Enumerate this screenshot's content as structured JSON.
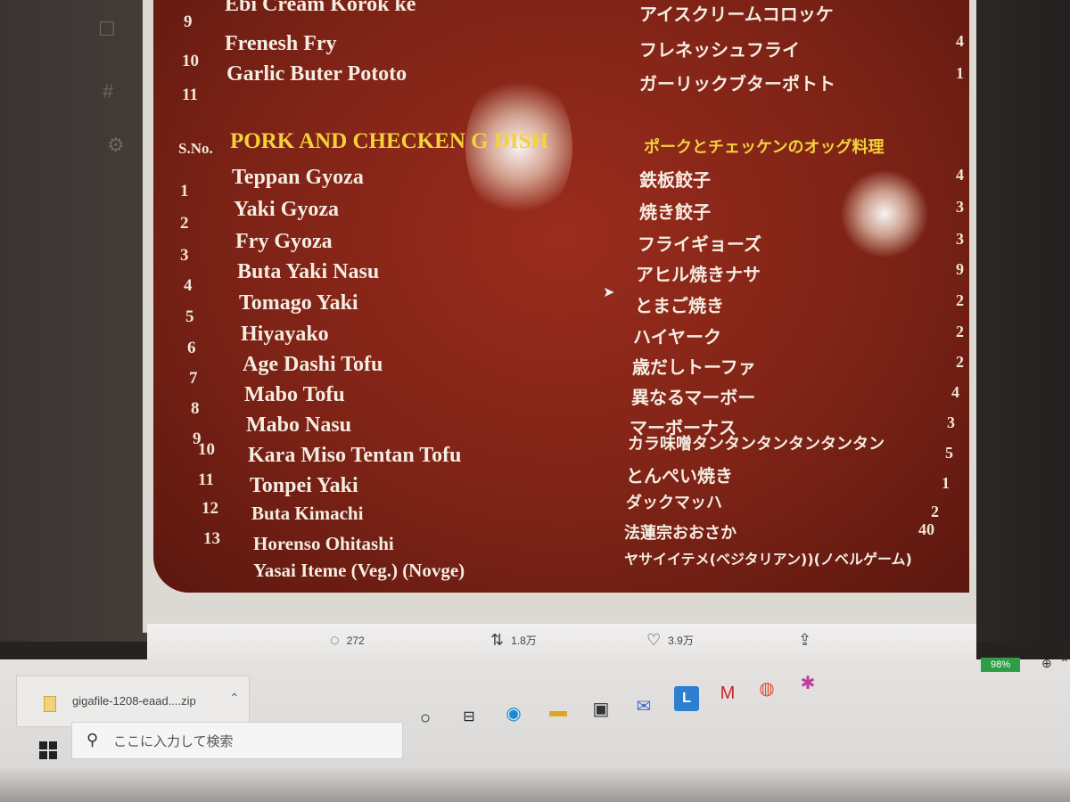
{
  "menu": {
    "top_items": [
      {
        "num": "9",
        "en": "Ebi Cream Korok ke",
        "jp": "アイスクリームコロッケ",
        "price": ""
      },
      {
        "num": "10",
        "en": "Frenesh Fry",
        "jp": "フレネッシュフライ",
        "price": "4"
      },
      {
        "num": "11",
        "en": "Garlic Buter Pototo",
        "jp": "ガーリックブターポトト",
        "price": "1"
      }
    ],
    "section": {
      "sno_label": "S.No.",
      "title": "PORK AND CHECKEN     G DISH",
      "title_jp": "ポークとチェッケンのオッグ料理"
    },
    "items": [
      {
        "num": "1",
        "en": "Teppan Gyoza",
        "jp": "鉄板餃子",
        "price": "4"
      },
      {
        "num": "2",
        "en": "Yaki Gyoza",
        "jp": "焼き餃子",
        "price": "3"
      },
      {
        "num": "3",
        "en": "Fry Gyoza",
        "jp": "フライギョーズ",
        "price": "3"
      },
      {
        "num": "4",
        "en": "Buta Yaki Nasu",
        "jp": "アヒル焼きナサ",
        "price": "9"
      },
      {
        "num": "5",
        "en": "Tomago Yaki",
        "jp": "とまご焼き",
        "price": "2"
      },
      {
        "num": "6",
        "en": "Hiyayako",
        "jp": "ハイヤーク",
        "price": "2"
      },
      {
        "num": "7",
        "en": "Age Dashi Tofu",
        "jp": "歳だしトーファ",
        "price": "2"
      },
      {
        "num": "8",
        "en": "Mabo Tofu",
        "jp": "異なるマーボー",
        "price": "4"
      },
      {
        "num": "9",
        "en": "Mabo Nasu",
        "jp": "マーボーナス",
        "price": "3"
      },
      {
        "num": "10",
        "en": "Kara Miso Tentan Tofu",
        "jp": "カラ味噌タンタンタンタンタンタン",
        "price": "5"
      },
      {
        "num": "11",
        "en": "Tonpei Yaki",
        "jp": "とんぺい焼き",
        "price": "1"
      },
      {
        "num": "12",
        "en": "Buta Kimachi",
        "jp": "ダックマッハ",
        "price": "2"
      },
      {
        "num": "13",
        "en": "Horenso Ohitashi",
        "jp": "法蓮宗おおさか",
        "price": "40"
      },
      {
        "num": "",
        "en": "Yasai Iteme (Veg.) (Novge)",
        "jp": "ヤサイイテメ(ベジタリアン))(ノベルゲーム)",
        "price": ""
      }
    ]
  },
  "tweet_actions": {
    "reply_count": "272",
    "retweet_count": "1.8万",
    "like_count": "3.9万"
  },
  "download": {
    "file_name": "gigafile-1208-eaad....zip"
  },
  "system": {
    "battery": "98%",
    "search_placeholder": "ここに入力して検索"
  },
  "colors": {
    "menu_red": "#7d2316",
    "section_yellow": "#f4d23a",
    "battery_green": "#2f9d45"
  }
}
